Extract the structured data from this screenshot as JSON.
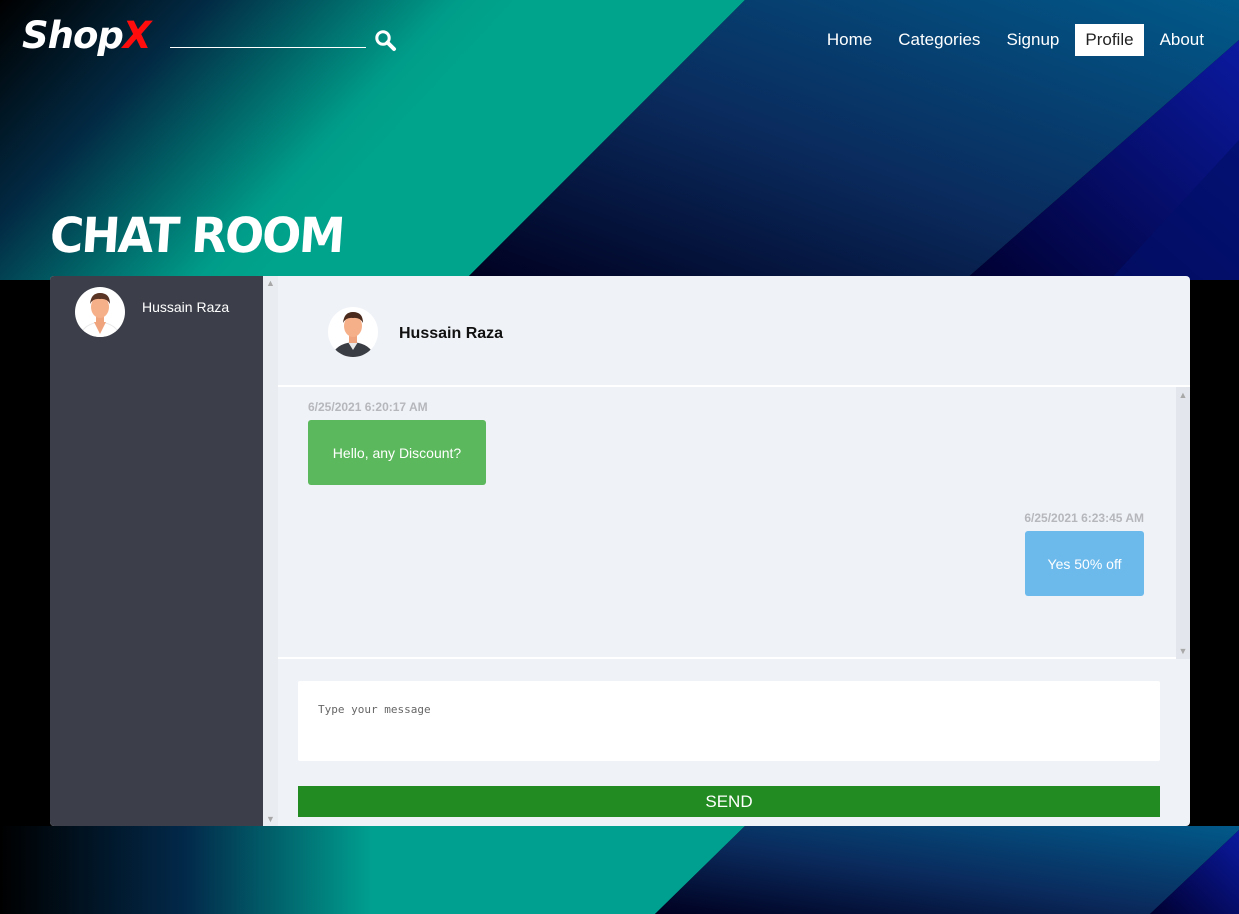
{
  "brand": {
    "name": "Shop",
    "accent": "X"
  },
  "search": {
    "icon": "search-icon"
  },
  "nav": {
    "items": [
      {
        "label": "Home"
      },
      {
        "label": "Categories"
      },
      {
        "label": "Signup"
      },
      {
        "label": "Profile",
        "active": true
      },
      {
        "label": "About"
      }
    ]
  },
  "page": {
    "title": "CHAT ROOM"
  },
  "sidebar": {
    "contacts": [
      {
        "name": "Hussain Raza",
        "avatar": "user-avatar-icon"
      }
    ]
  },
  "chat": {
    "header_name": "Hussain Raza",
    "messages": [
      {
        "time": "6/25/2021 6:20:17 AM",
        "text": "Hello, any Discount?",
        "direction": "received"
      },
      {
        "time": "6/25/2021 6:23:45 AM",
        "text": "Yes 50% off",
        "direction": "sent"
      }
    ],
    "composer_placeholder": "Type your message",
    "send_label": "SEND"
  },
  "colors": {
    "brand_accent": "#ff0d0d",
    "received_bubble": "#5cb85c",
    "sent_bubble": "#6cb9ec",
    "send_button": "#228b22",
    "sidebar_bg": "#3c3f4a"
  }
}
